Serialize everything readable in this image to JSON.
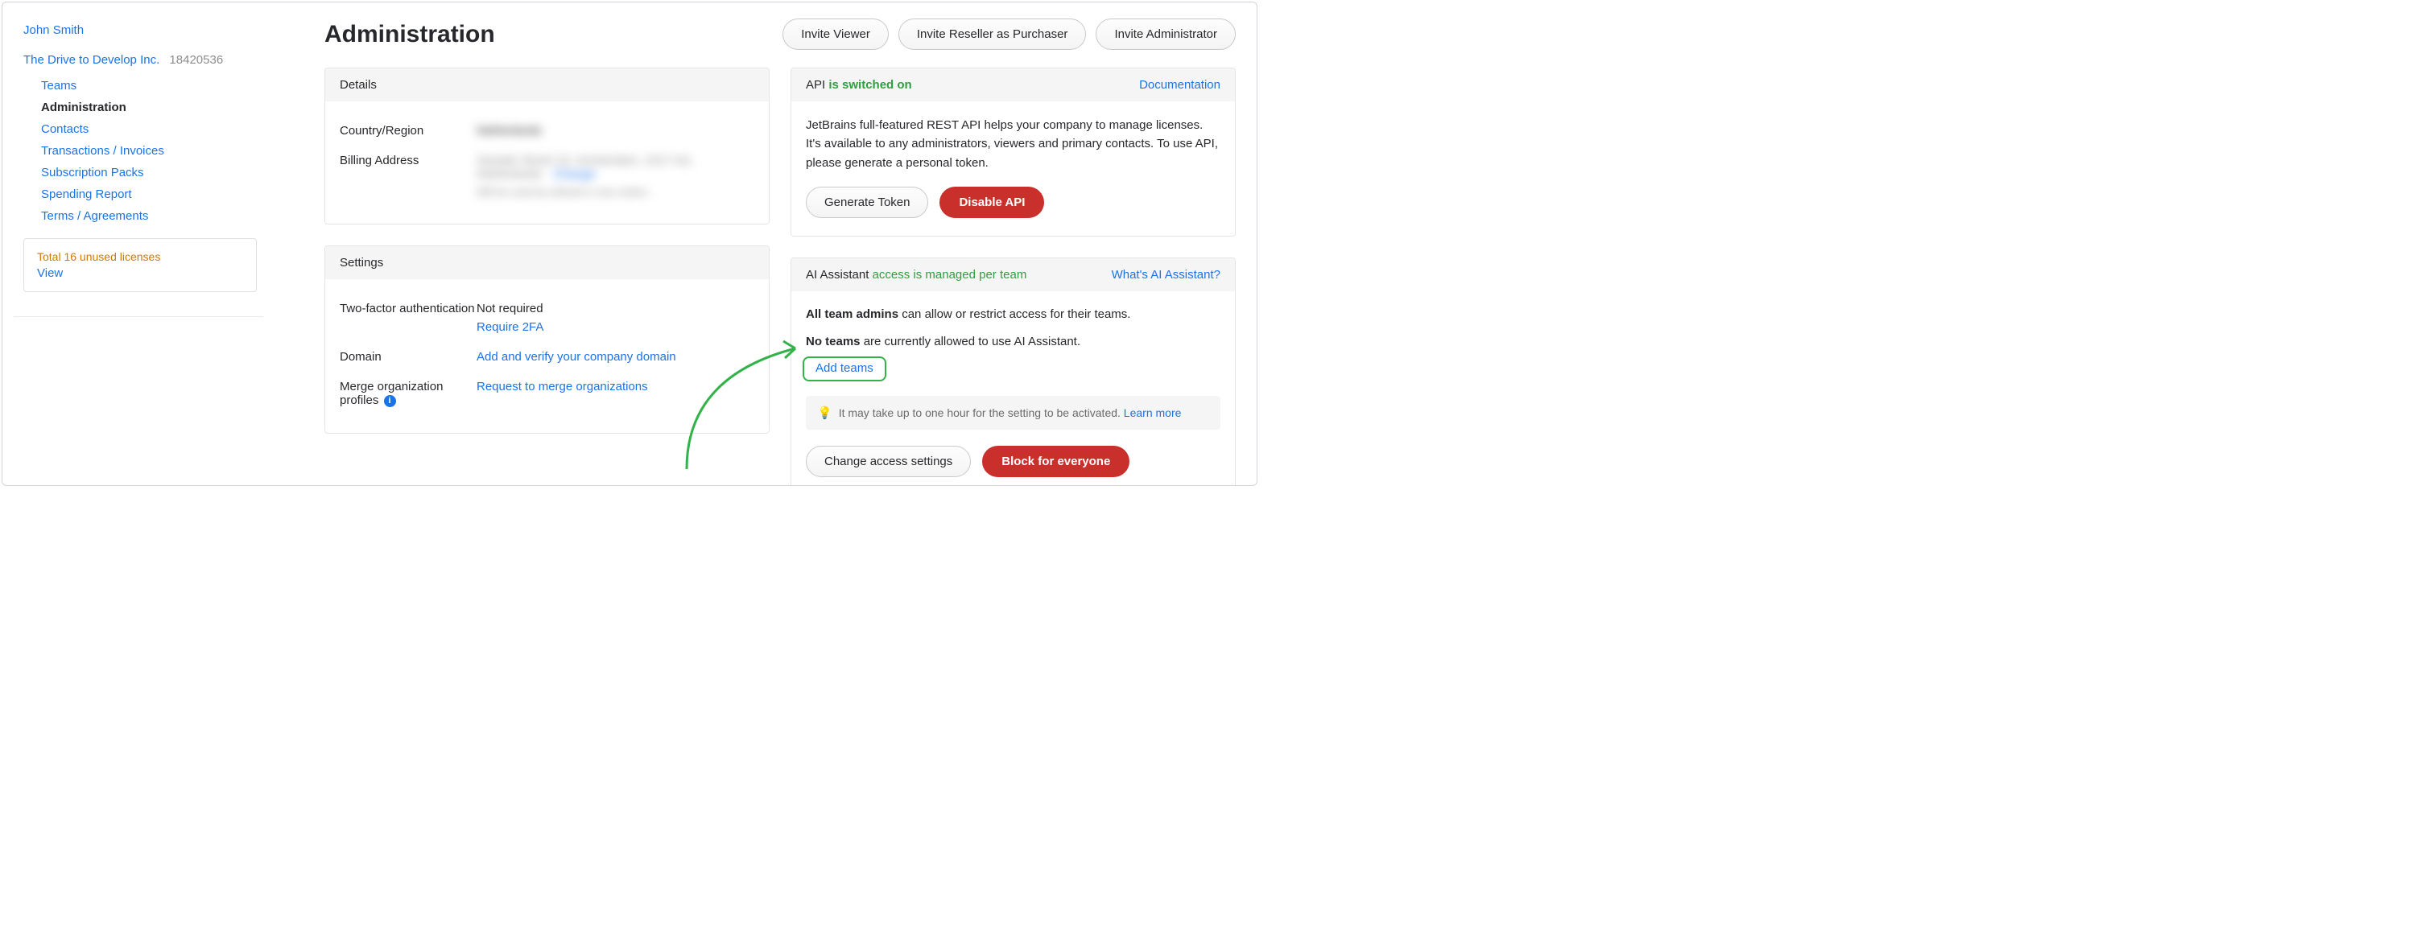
{
  "user": {
    "name": "John Smith"
  },
  "org": {
    "name": "The Drive to Develop Inc.",
    "id": "18420536"
  },
  "nav": {
    "teams": "Teams",
    "administration": "Administration",
    "contacts": "Contacts",
    "transactions": "Transactions / Invoices",
    "packs": "Subscription Packs",
    "spending": "Spending Report",
    "terms": "Terms / Agreements"
  },
  "licenses": {
    "total": "Total 16 unused licenses",
    "view": "View"
  },
  "page": {
    "title": "Administration"
  },
  "topActions": {
    "inviteViewer": "Invite Viewer",
    "inviteReseller": "Invite Reseller as Purchaser",
    "inviteAdmin": "Invite Administrator"
  },
  "details": {
    "header": "Details",
    "countryLabel": "Country/Region",
    "countryValue": "Netherlands",
    "billingLabel": "Billing Address",
    "billingLine1": "Sample Street 10, Amsterdam, 1017 AA,",
    "billingLine2": "Netherlands",
    "billingChange": "Change",
    "billingNote": "Will be used by default in new orders."
  },
  "settings": {
    "header": "Settings",
    "twoFaLabel": "Two-factor authentication",
    "twoFaStatus": "Not required",
    "twoFaAction": "Require 2FA",
    "domainLabel": "Domain",
    "domainAction": "Add and verify your company domain",
    "mergeLabel": "Merge organization profiles",
    "mergeAction": "Request to merge organizations"
  },
  "api": {
    "titlePrefix": "API ",
    "titleStatus": "is switched on",
    "docLink": "Documentation",
    "desc": "JetBrains full-featured REST API helps your company to manage licenses. It's available to any administrators, viewers and primary contacts. To use API, please generate a personal token.",
    "generate": "Generate Token",
    "disable": "Disable API"
  },
  "ai": {
    "titlePrefix": "AI Assistant ",
    "titleStatus": "access is managed per team",
    "whatIs": "What's AI Assistant?",
    "line1a": "All team admins",
    "line1b": " can allow or restrict access for their teams.",
    "line2a": "No teams",
    "line2b": " are currently allowed to use AI Assistant.",
    "addTeams": "Add teams",
    "hint": "It may take up to one hour for the setting to be activated. ",
    "learnMore": "Learn more",
    "changeAccess": "Change access settings",
    "block": "Block for everyone"
  }
}
